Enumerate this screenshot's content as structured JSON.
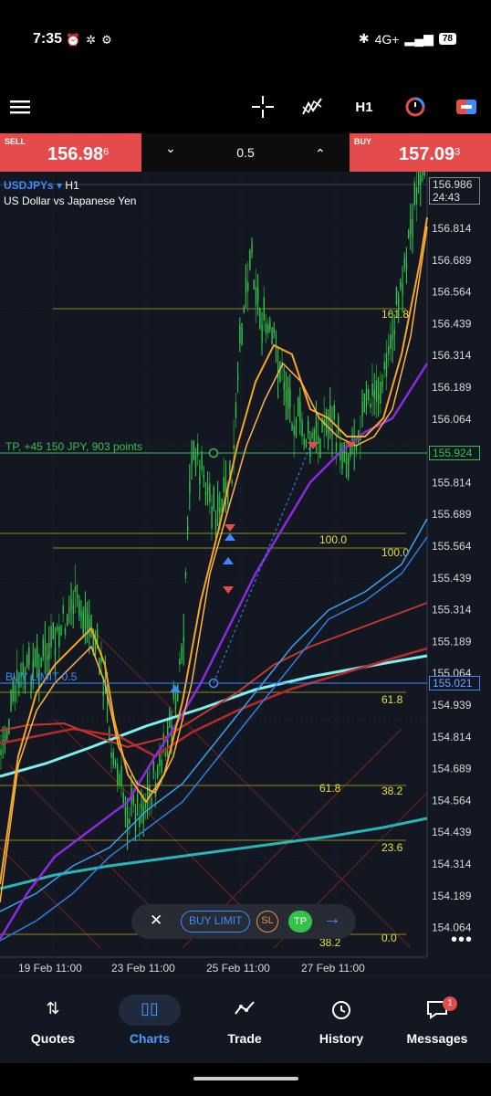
{
  "status": {
    "time": "7:35",
    "network": "4G+",
    "battery": "78"
  },
  "toolbar": {
    "timeframe": "H1"
  },
  "trade": {
    "sell_label": "SELL",
    "sell_main": "156.98",
    "sell_sup": "6",
    "buy_label": "BUY",
    "buy_main": "157.09",
    "buy_sup": "3",
    "lot": "0.5"
  },
  "chart": {
    "symbol": "USDJPYs",
    "symbol_arrow": "▾",
    "timeframe": "H1",
    "description": "US Dollar vs Japanese Yen",
    "current_price": "156.986",
    "countdown": "24:43",
    "tp_label": "TP, +45 150 JPY, 903 points",
    "tp_price": "155.924",
    "buy_limit_label": "BUY LIMIT 0.5",
    "buy_limit_price": "155.021",
    "price_axis": [
      "156.814",
      "156.689",
      "156.564",
      "156.439",
      "156.314",
      "156.189",
      "156.064",
      "155.814",
      "155.689",
      "155.564",
      "155.439",
      "155.314",
      "155.189",
      "155.064",
      "154.939",
      "154.814",
      "154.689",
      "154.564",
      "154.439",
      "154.314",
      "154.189",
      "154.064"
    ],
    "time_axis": [
      "19 Feb 11:00",
      "23 Feb 11:00",
      "25 Feb 11:00",
      "27 Feb 11:00"
    ],
    "fib_labels": [
      "161.8",
      "100.0",
      "100.0",
      "61.8",
      "61.8",
      "38.2",
      "23.6",
      "38.2",
      "0.0"
    ],
    "colors": {
      "bg": "#131722",
      "candle": "#33c24b",
      "tp_line": "#33c24b",
      "buy_limit": "#3d8bff",
      "fib": "#c8c832",
      "ma_orange": "#f5a623",
      "ma_purple": "#8a2be2",
      "ma_red": "#c0392b",
      "ma_cyan": "#5ee8e8",
      "ma_blue": "#2f7de1"
    }
  },
  "order_toolbar": {
    "buy_limit": "BUY LIMIT",
    "sl": "SL",
    "tp": "TP"
  },
  "nav": [
    {
      "label": "Quotes",
      "icon": "quotes-icon"
    },
    {
      "label": "Charts",
      "icon": "charts-icon"
    },
    {
      "label": "Trade",
      "icon": "trade-icon"
    },
    {
      "label": "History",
      "icon": "history-icon"
    },
    {
      "label": "Messages",
      "icon": "messages-icon",
      "badge": "1"
    }
  ]
}
